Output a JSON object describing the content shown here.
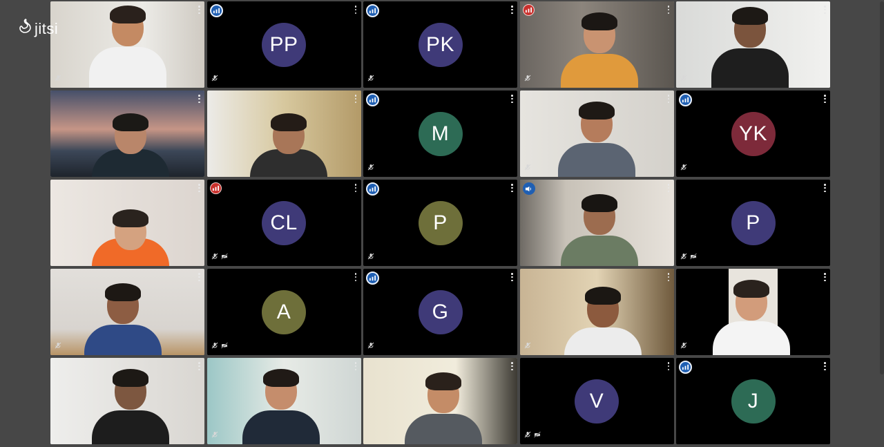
{
  "app": {
    "watermark": "jitsi",
    "watermark_icon": "jitsi-logo"
  },
  "colors": {
    "background": "#474747",
    "tile_background": "#000000",
    "avatar_purple": "#3f3a78",
    "avatar_green": "#2d6b55",
    "avatar_maroon": "#7d2a3a",
    "avatar_olive": "#6e6f3a",
    "connection_good": "#1f5fb3",
    "connection_poor": "#c9302c"
  },
  "participants": [
    {
      "type": "video",
      "indicator": "",
      "audio_muted": true,
      "video_muted": false,
      "scene": "s1"
    },
    {
      "type": "avatar",
      "initials": "PP",
      "avatar_color": "#3f3a78",
      "indicator": "connection",
      "audio_muted": true,
      "video_muted": false
    },
    {
      "type": "avatar",
      "initials": "PK",
      "avatar_color": "#3f3a78",
      "indicator": "connection",
      "audio_muted": true,
      "video_muted": false
    },
    {
      "type": "video",
      "indicator": "poor-connection",
      "audio_muted": true,
      "video_muted": false,
      "scene": "s4"
    },
    {
      "type": "video",
      "indicator": "",
      "audio_muted": true,
      "video_muted": false,
      "scene": "s5"
    },
    {
      "type": "video",
      "indicator": "",
      "audio_muted": false,
      "video_muted": false,
      "scene": "s6"
    },
    {
      "type": "video",
      "indicator": "",
      "audio_muted": false,
      "video_muted": false,
      "scene": "s7"
    },
    {
      "type": "avatar",
      "initials": "M",
      "avatar_color": "#2d6b55",
      "indicator": "connection",
      "audio_muted": true,
      "video_muted": false
    },
    {
      "type": "video",
      "indicator": "",
      "audio_muted": true,
      "video_muted": false,
      "scene": "s9"
    },
    {
      "type": "avatar",
      "initials": "YK",
      "avatar_color": "#7d2a3a",
      "indicator": "connection",
      "audio_muted": true,
      "video_muted": false
    },
    {
      "type": "video",
      "indicator": "",
      "audio_muted": false,
      "video_muted": false,
      "scene": "s11"
    },
    {
      "type": "avatar",
      "initials": "CL",
      "avatar_color": "#3f3a78",
      "indicator": "poor-connection",
      "audio_muted": true,
      "video_muted": true
    },
    {
      "type": "avatar",
      "initials": "P",
      "avatar_color": "#6e6f3a",
      "indicator": "connection",
      "audio_muted": true,
      "video_muted": false
    },
    {
      "type": "video",
      "indicator": "speaking",
      "audio_muted": false,
      "video_muted": false,
      "scene": "s14",
      "active": true
    },
    {
      "type": "avatar",
      "initials": "P",
      "avatar_color": "#3f3a78",
      "indicator": "",
      "audio_muted": true,
      "video_muted": true
    },
    {
      "type": "video",
      "indicator": "",
      "audio_muted": true,
      "video_muted": false,
      "scene": "s16"
    },
    {
      "type": "avatar",
      "initials": "A",
      "avatar_color": "#6e6f3a",
      "indicator": "",
      "audio_muted": true,
      "video_muted": true
    },
    {
      "type": "avatar",
      "initials": "G",
      "avatar_color": "#3f3a78",
      "indicator": "connection",
      "audio_muted": true,
      "video_muted": false
    },
    {
      "type": "video",
      "indicator": "",
      "audio_muted": true,
      "video_muted": false,
      "scene": "s19"
    },
    {
      "type": "video",
      "indicator": "",
      "audio_muted": true,
      "video_muted": false,
      "scene": "s20"
    },
    {
      "type": "video",
      "indicator": "",
      "audio_muted": false,
      "video_muted": false,
      "scene": "s21"
    },
    {
      "type": "video",
      "indicator": "",
      "audio_muted": true,
      "video_muted": false,
      "scene": "s22"
    },
    {
      "type": "video",
      "indicator": "",
      "audio_muted": false,
      "video_muted": false,
      "scene": "s23"
    },
    {
      "type": "avatar",
      "initials": "V",
      "avatar_color": "#3f3a78",
      "indicator": "",
      "audio_muted": true,
      "video_muted": true
    },
    {
      "type": "avatar",
      "initials": "J",
      "avatar_color": "#2d6b55",
      "indicator": "connection",
      "audio_muted": false,
      "video_muted": false
    }
  ]
}
